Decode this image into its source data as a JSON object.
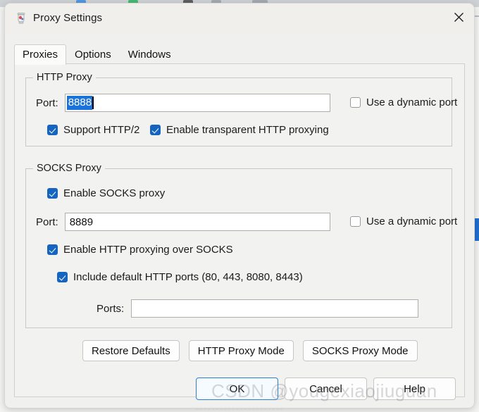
{
  "window": {
    "title": "Proxy Settings",
    "icon": "proxy-app-icon",
    "close_label": "✕"
  },
  "tabs": [
    {
      "label": "Proxies",
      "active": true
    },
    {
      "label": "Options",
      "active": false
    },
    {
      "label": "Windows",
      "active": false
    }
  ],
  "http_proxy": {
    "group_title": "HTTP Proxy",
    "port_label": "Port:",
    "port_value": "8888",
    "port_selected": true,
    "dynamic_port_label": "Use a dynamic port",
    "dynamic_port_checked": false,
    "support_http2_label": "Support HTTP/2",
    "support_http2_checked": true,
    "transparent_label": "Enable transparent HTTP proxying",
    "transparent_checked": true
  },
  "socks_proxy": {
    "group_title": "SOCKS Proxy",
    "enable_label": "Enable SOCKS proxy",
    "enable_checked": true,
    "port_label": "Port:",
    "port_value": "8889",
    "dynamic_port_label": "Use a dynamic port",
    "dynamic_port_checked": false,
    "http_over_socks_label": "Enable HTTP proxying over SOCKS",
    "http_over_socks_checked": true,
    "include_default_ports_label": "Include default HTTP ports (80, 443, 8080, 8443)",
    "include_default_ports_checked": true,
    "ports_label": "Ports:",
    "ports_value": "",
    "ports_placeholder": ""
  },
  "mode_buttons": [
    {
      "label": "Restore Defaults"
    },
    {
      "label": "HTTP Proxy Mode"
    },
    {
      "label": "SOCKS Proxy Mode"
    }
  ],
  "dialog_buttons": [
    {
      "label": "OK",
      "default": true
    },
    {
      "label": "Cancel",
      "default": false
    },
    {
      "label": "Help",
      "default": false
    }
  ],
  "watermark": "CSDN @yougexiaojiuguan",
  "colors": {
    "accent": "#1565c0",
    "selection": "#1a73d9",
    "default_button_border": "#2b7cd3",
    "dialog_background": "#f0f0ee",
    "panel_background": "#f2f2f0"
  }
}
